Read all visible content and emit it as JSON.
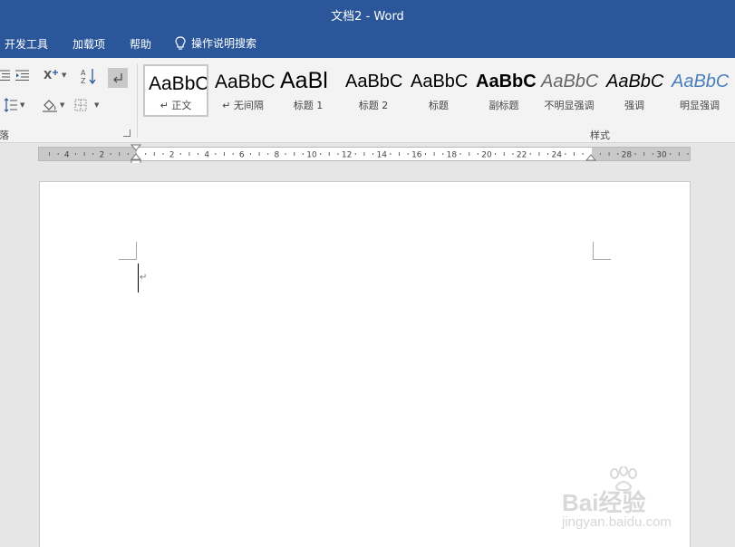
{
  "window": {
    "title": "文档2  -  Word"
  },
  "tabs": [
    {
      "label": "开发工具"
    },
    {
      "label": "加载项"
    },
    {
      "label": "帮助"
    }
  ],
  "tell_me": {
    "label": "操作说明搜索",
    "icon": "lightbulb-icon"
  },
  "ribbon": {
    "paragraph_group_label": "段落",
    "styles_group_label": "样式",
    "styles": [
      {
        "sample": "AaBbC",
        "name": "↵ 正文",
        "selected": true
      },
      {
        "sample": "AaBbC",
        "name": "↵ 无间隔"
      },
      {
        "sample": "AaBl",
        "name": "标题 1"
      },
      {
        "sample": "AaBbC",
        "name": "标题 2"
      },
      {
        "sample": "AaBbC",
        "name": "标题"
      },
      {
        "sample": "AaBbC",
        "name": "副标题"
      },
      {
        "sample": "AaBbC",
        "name": "不明显强调"
      },
      {
        "sample": "AaBbC",
        "name": "强调"
      },
      {
        "sample": "AaBbC",
        "name": "明显强调"
      }
    ],
    "accent_color": "#2b579a"
  },
  "ruler": {
    "left_labels": [
      "4",
      "2"
    ],
    "right_labels": [
      "2",
      "4",
      "6",
      "8",
      "10",
      "12",
      "14",
      "16",
      "18",
      "20",
      "22",
      "24",
      "28",
      "30"
    ]
  },
  "document": {
    "paragraph_mark": "↵"
  },
  "watermark": {
    "text": "Bai经验",
    "sub": "jingyan.baidu.com"
  }
}
